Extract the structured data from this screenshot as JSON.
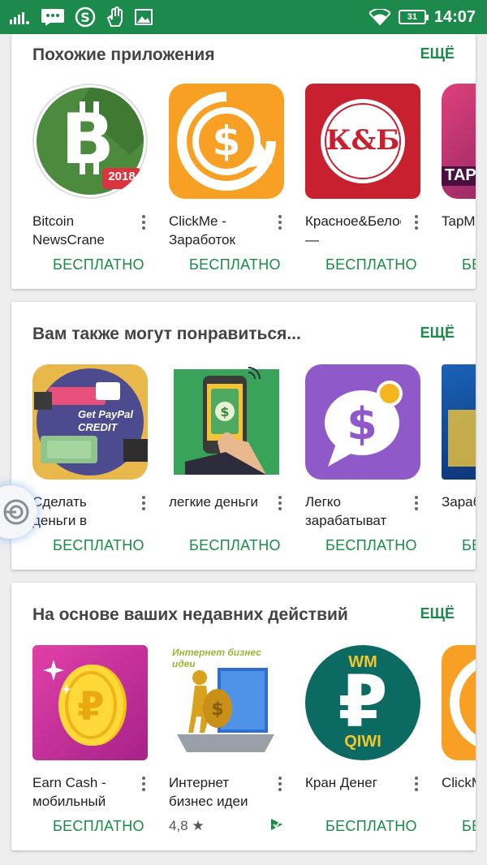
{
  "status_bar": {
    "time": "14:07",
    "battery": "31",
    "icons": [
      "signal-icon",
      "message-icon",
      "dollar-app-icon",
      "hand-app-icon",
      "image-icon",
      "wifi-icon",
      "battery-icon"
    ]
  },
  "colors": {
    "status_bar": "#1b8a4b",
    "accent": "#1b8a4b"
  },
  "sections": [
    {
      "title": "Похожие приложения",
      "more": "ЕЩЁ",
      "apps": [
        {
          "name": "Bitcoin NewsCrane",
          "price": "БЕСПЛАТНО",
          "icon": "bitcoin-app-icon",
          "badge": "2018"
        },
        {
          "name": "ClickMe - Заработок",
          "price": "БЕСПЛАТНО",
          "icon": "dollar-refresh-app-icon"
        },
        {
          "name": "Красное&Белое —",
          "price": "БЕСПЛАТНО",
          "icon": "kb-app-icon",
          "badge": "К&Б"
        },
        {
          "name": "TapМ Моби",
          "price": "БЕ",
          "icon": "tap-app-icon"
        }
      ]
    },
    {
      "title": "Вам также могут понравиться...",
      "more": "ЕЩЁ",
      "apps": [
        {
          "name": "Сделать деньги в",
          "price": "БЕСПЛАТНО",
          "icon": "paypal-credit-app-icon",
          "badge": "Get PayPal CREDIT"
        },
        {
          "name": "легкие деньги",
          "price": "БЕСПЛАТНО",
          "icon": "phone-money-app-icon"
        },
        {
          "name": "Легко зарабатыват",
          "price": "БЕСПЛАТНО",
          "icon": "dollar-chat-app-icon"
        },
        {
          "name": "Зараб те дев",
          "price": "БЕ",
          "icon": "blue-app-icon"
        }
      ]
    },
    {
      "title": "На основе ваших недавних действий",
      "more": "ЕЩЁ",
      "apps": [
        {
          "name": "Earn Cash - мобильный",
          "price": "БЕСПЛАТНО",
          "icon": "ruble-coin-app-icon"
        },
        {
          "name": "Интернет бизнес идеи",
          "rating": "4,8 ★",
          "icon": "business-ideas-app-icon",
          "badge": "Интернет бизнес идеи"
        },
        {
          "name": "Кран Денег",
          "price": "БЕСПЛАТНО",
          "icon": "wm-qiwi-app-icon",
          "badge_top": "WM",
          "badge_bottom": "QIWI"
        },
        {
          "name": "ClickM Зараб",
          "price": "БЕ",
          "icon": "click-app-icon"
        }
      ]
    }
  ]
}
